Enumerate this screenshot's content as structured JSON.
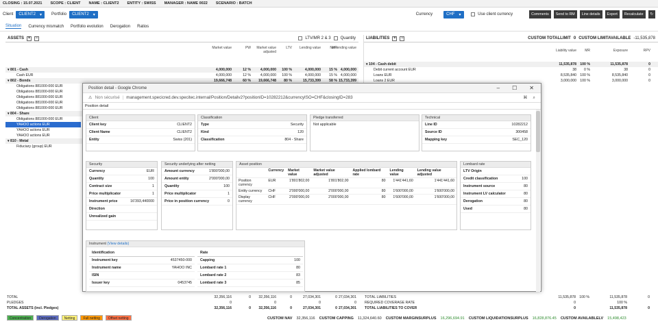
{
  "topbar": {
    "closing": "CLOSING : 15.07.2021",
    "scope": "SCOPE : CLIENT",
    "name": "NAME : CLIENT2",
    "entity": "ENTITY : SWISS",
    "manager": "MANAGER : NAME 0022",
    "scenario": "SCENARIO : BATCH"
  },
  "toolbar": {
    "client_label": "Client",
    "client_value": "CLIENT2",
    "portfolio_label": "Portfolio",
    "portfolio_value": "CLIENT2",
    "currency_label": "Currency",
    "currency_value": "CHF",
    "use_client_currency": "Use client currency",
    "buttons": [
      "Comments",
      "Send to RM",
      "Line details",
      "Export",
      "Recalculate"
    ]
  },
  "tabs": [
    "Situation",
    "Currency mismatch",
    "Portfolio evolution",
    "Derogation",
    "Ratios"
  ],
  "assets": {
    "title": "ASSETS",
    "ltv_check": "LTV/MR 2 & 3",
    "quantity_check": "Quantity",
    "headers": [
      "Market value",
      "PW",
      "Market value adjusted",
      "LTV",
      "Lending value",
      "WR",
      "Net lending value"
    ],
    "rows": [
      {
        "label": "801 - Cash",
        "vals": [
          "4,000,000",
          "12 %",
          "4,000,000",
          "100 %",
          "4,000,000",
          "15 %",
          "4,000,000"
        ],
        "type": "cat"
      },
      {
        "label": "Cash EUR",
        "vals": [
          "4,000,000",
          "12 %",
          "4,000,000",
          "100 %",
          "4,000,000",
          "15 %",
          "4,000,000"
        ],
        "type": "item"
      },
      {
        "label": "802 - Bonds",
        "vals": [
          "19,666,748",
          "60 %",
          "19,666,748",
          "80 %",
          "15,733,399",
          "58 %",
          "15,733,399"
        ],
        "type": "cat"
      },
      {
        "label": "Obligations 881000-000 EUR",
        "vals": [],
        "type": "item"
      },
      {
        "label": "Obligations 881000-000 EUR",
        "vals": [],
        "type": "item"
      },
      {
        "label": "Obligations 881000-000 EUR",
        "vals": [],
        "type": "item"
      },
      {
        "label": "Obligations 881000-000 EUR",
        "vals": [],
        "type": "item"
      },
      {
        "label": "Obligations 881000-000 EUR",
        "vals": [],
        "type": "item"
      },
      {
        "label": "804 - Share",
        "vals": [],
        "type": "cat"
      },
      {
        "label": "Obligations 881000-000 EUR",
        "vals": [],
        "type": "item"
      },
      {
        "label": "YAHOO actions EUR",
        "vals": [],
        "type": "sel"
      },
      {
        "label": "YAHOO actions EUR",
        "vals": [],
        "type": "item"
      },
      {
        "label": "YAHOO actions EUR",
        "vals": [],
        "type": "item"
      },
      {
        "label": "810 - Metal",
        "vals": [],
        "type": "cat"
      },
      {
        "label": "Fiduciary (group) EUR",
        "vals": [],
        "type": "item"
      }
    ]
  },
  "liabilities": {
    "title": "LIABILITIES",
    "limit_label": "CUSTOM TOTALLIMIT",
    "limit_value": "0",
    "avail_label": "CUSTOM LIMITAVAILABLE",
    "avail_value": "-11,535,878",
    "headers": [
      "Liability value",
      "MR",
      "Exposure",
      "RPV"
    ],
    "rows": [
      {
        "label": "104 - Cash debit",
        "vals": [
          "11,535,878",
          "100 %",
          "11,535,878",
          "0"
        ],
        "type": "cat"
      },
      {
        "label": "Debit current account EUR",
        "vals": [
          "38",
          "0 %",
          "38",
          "0"
        ],
        "type": "item"
      },
      {
        "label": "Loans EUR",
        "vals": [
          "8,535,840",
          "100 %",
          "8,535,840",
          "0"
        ],
        "type": "item"
      },
      {
        "label": "Loans 2 EUR",
        "vals": [
          "3,000,000",
          "100 %",
          "3,000,000",
          "0"
        ],
        "type": "item"
      }
    ]
  },
  "totals_left": [
    {
      "label": "TOTAL",
      "vals": [
        "32,356,116",
        "0",
        "32,356,116",
        "0",
        "27,034,301",
        "0",
        "27,034,301"
      ]
    },
    {
      "label": "PLEDGES",
      "vals": [
        "0",
        "",
        "0",
        "",
        "0",
        "",
        "0"
      ]
    },
    {
      "label": "TOTAL ASSETS (incl. Pledges)",
      "vals": [
        "32,356,116",
        "0",
        "32,356,116",
        "0",
        "27,034,301",
        "0",
        "27,034,301"
      ]
    }
  ],
  "totals_right": [
    {
      "label": "TOTAL LIABILITIES",
      "vals": [
        "11,535,878",
        "100 %",
        "11,535,878",
        "0"
      ]
    },
    {
      "label": "REQUIRED COVERAGE RATE",
      "vals": [
        "0",
        "",
        "100 %",
        ""
      ]
    },
    {
      "label": "TOTAL LIABILITIES TO COVER",
      "vals": [
        "0",
        "",
        "11,535,878",
        "0"
      ]
    }
  ],
  "legend": [
    "Concentration",
    "Derogation",
    "Netting",
    "Full netting",
    "Offset netting"
  ],
  "legend_colors": [
    "#4caf50",
    "#5c6bc0",
    "#fff176",
    "#ff9800",
    "#ff7043"
  ],
  "bottombar": [
    {
      "label": "CUSTOM NAV",
      "value": "32,356,116"
    },
    {
      "label": "CUSTOM CAPPING",
      "value": "11,324,640.60"
    },
    {
      "label": "CUSTOM MARGINSURPLUS",
      "value": "16,296,694.91"
    },
    {
      "label": "CUSTOM LIQUIDATIONSURPLUS",
      "value": "16,828,876.45"
    },
    {
      "label": "CUSTOM AVAILABLELV",
      "value": "15,498,423"
    }
  ],
  "modal": {
    "window_title": "Position detail - Google Chrome",
    "security_warning": "Non sécurisé",
    "url": "management.specicred.dev.specitec.internal/Position/Detailv2?positionID=10282212&currencyISO=CHF&closingID=283",
    "page_title": "Position detail",
    "client": {
      "title": "Client",
      "rows": [
        [
          "Client key",
          "CLIENT2"
        ],
        [
          "Client Name",
          "CLIENT2"
        ],
        [
          "Entity",
          "Swiss (201)"
        ]
      ]
    },
    "classification": {
      "title": "Classification",
      "rows": [
        [
          "Type",
          "Security"
        ],
        [
          "Kind",
          "120"
        ],
        [
          "Classification",
          "804 - Share"
        ]
      ]
    },
    "pledge": {
      "title": "Pledge transferred",
      "text": "Not applicable"
    },
    "technical": {
      "title": "Technical",
      "rows": [
        [
          "Line ID",
          "10282212"
        ],
        [
          "Source ID",
          "300458"
        ],
        [
          "Mapping key",
          "SEC_120"
        ]
      ]
    },
    "security": {
      "title": "Security",
      "rows": [
        [
          "Currency",
          "EUR"
        ],
        [
          "Quantity",
          "100"
        ],
        [
          "Contract size",
          "1"
        ],
        [
          "Price multiplicator",
          "1"
        ],
        [
          "Instrument price",
          "16'393,440000"
        ],
        [
          "Direction",
          ""
        ],
        [
          "Unrealized gain",
          ""
        ]
      ]
    },
    "underlying": {
      "title": "Security underlying after netting",
      "rows": [
        [
          "Amount currency",
          "1'800'000,00"
        ],
        [
          "Amount entity",
          "2'000'000,00"
        ],
        [
          "Quantity",
          "100"
        ],
        [
          "Price multiplicator",
          "1"
        ],
        [
          "Price in position currency",
          "0"
        ]
      ]
    },
    "asset_position": {
      "title": "Asset position",
      "headers": [
        "",
        "Currency",
        "Market value",
        "Market value adjusted",
        "Applied lombard rate",
        "Lending value",
        "Lending value adjusted"
      ],
      "rows": [
        [
          "Position currency",
          "EUR",
          "1'801'802,00",
          "1'801'802,00",
          "80",
          "1'441'441,60",
          "1'441'441,60"
        ],
        [
          "Entity currency",
          "CHF",
          "2'000'000,00",
          "2'000'000,00",
          "80",
          "1'600'000,00",
          "1'600'000,00"
        ],
        [
          "Display currency",
          "CHF",
          "2'000'000,00",
          "2'000'000,00",
          "80",
          "1'600'000,00",
          "1'600'000,00"
        ]
      ]
    },
    "lombard": {
      "title": "Lombard rate",
      "rows": [
        [
          "LTV Origin",
          ""
        ],
        [
          "Credit classification",
          "100"
        ],
        [
          "Instrument source",
          "80"
        ],
        [
          "Instrument LV calculator",
          "80"
        ],
        [
          "Derogation",
          "80"
        ],
        [
          "Used",
          "80"
        ]
      ]
    },
    "instrument": {
      "title": "Instrument",
      "link": "(View details)",
      "ident_header": "Identification",
      "rate_header": "Rate",
      "ident_rows": [
        [
          "Instrument key",
          "4537450-000"
        ],
        [
          "Instrument name",
          "YAHOO INC"
        ],
        [
          "ISIN",
          ""
        ],
        [
          "Issuer key",
          "0453745"
        ]
      ],
      "rate_rows": [
        [
          "Capping",
          "100"
        ],
        [
          "Lombard rate 1",
          "80"
        ],
        [
          "Lombard rate 2",
          "83"
        ],
        [
          "Lombard rate 3",
          "85"
        ]
      ]
    }
  }
}
